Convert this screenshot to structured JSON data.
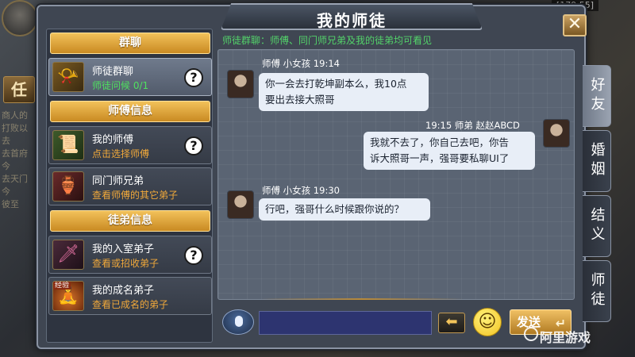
{
  "window": {
    "title": "我的师徒",
    "close_label": "✕"
  },
  "background": {
    "task_tab": "任",
    "coords": "[179.55]",
    "side_log": [
      "商人的",
      "打败以",
      "去",
      "去首府",
      "今",
      "去天门",
      "今",
      "彼至"
    ]
  },
  "sections": {
    "group_chat": "群聊",
    "master_info": "师傅信息",
    "disciple_info": "徒弟信息"
  },
  "entries": [
    {
      "title": "师徒群聊",
      "subtitle": "师徒问候 0/1",
      "icon": "horn-icon",
      "help": "?"
    },
    {
      "title": "我的师傅",
      "subtitle": "点击选择师傅",
      "icon": "scroll-icon",
      "help": "?"
    },
    {
      "title": "同门师兄弟",
      "subtitle": "查看师傅的其它弟子",
      "icon": "vase-icon"
    },
    {
      "title": "我的入室弟子",
      "subtitle": "查看或招收弟子",
      "icon": "blade-icon",
      "help": "?"
    },
    {
      "title": "我的成名弟子",
      "subtitle": "查看已成名的弟子",
      "icon": "meditation-icon",
      "badge": "经验"
    }
  ],
  "chat": {
    "notice": "师徒群聊：师傅、同门师兄弟及我的徒弟均可看见",
    "messages": [
      {
        "head": "师傅  小女孩  19:14",
        "lines": [
          "你一会去打乾坤副本么，我10点",
          "要出去接大照哥"
        ],
        "side": "left"
      },
      {
        "head": "19:15  师弟  赵赵ABCD",
        "lines": [
          "我就不去了，你自己去吧，你告",
          "诉大照哥一声，强哥要私聊UI了"
        ],
        "side": "right"
      },
      {
        "head": "师傅  小女孩  19:30",
        "lines": [
          "行吧，强哥什么时候跟你说的？"
        ],
        "side": "left"
      }
    ]
  },
  "input": {
    "value": "",
    "send_label": "发送",
    "send_icon": "↵",
    "arrow_label": "⬅",
    "emoji": "☺"
  },
  "tabs": [
    "好友",
    "婚姻",
    "结义",
    "师徒"
  ],
  "watermark": "阿里游戏"
}
